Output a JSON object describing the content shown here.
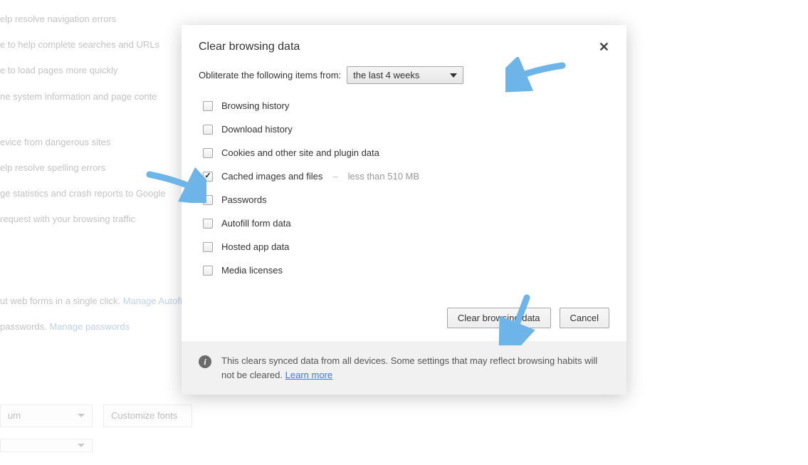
{
  "bg": {
    "lines": [
      "elp resolve navigation errors",
      "e to help complete searches and URLs",
      "e to load pages more quickly",
      "ne system information and page conte",
      "evice from dangerous sites",
      "elp resolve spelling errors",
      "ge statistics and crash reports to Google",
      "request with your browsing traffic"
    ],
    "forms_line_prefix": "ut web forms in a single click. ",
    "forms_link": "Manage Autofill settings",
    "passwords_line_prefix": " passwords. ",
    "passwords_link": "Manage passwords",
    "select1": "um",
    "select2": "Customize fonts"
  },
  "dialog": {
    "title": "Clear browsing data",
    "obliterate_label": "Obliterate the following items from:",
    "timeframe": "the last 4 weeks",
    "items": [
      {
        "label": "Browsing history",
        "checked": false,
        "extra": ""
      },
      {
        "label": "Download history",
        "checked": false,
        "extra": ""
      },
      {
        "label": "Cookies and other site and plugin data",
        "checked": false,
        "extra": ""
      },
      {
        "label": "Cached images and files",
        "checked": true,
        "extra": "less than 510 MB"
      },
      {
        "label": "Passwords",
        "checked": false,
        "extra": ""
      },
      {
        "label": "Autofill form data",
        "checked": false,
        "extra": ""
      },
      {
        "label": "Hosted app data",
        "checked": false,
        "extra": ""
      },
      {
        "label": "Media licenses",
        "checked": false,
        "extra": ""
      }
    ],
    "primary_button": "Clear browsing data",
    "cancel_button": "Cancel",
    "footer_text": "This clears synced data from all devices. Some settings that may reflect browsing habits will not be cleared. ",
    "footer_link": "Learn more"
  },
  "arrow_color": "#6db5e8"
}
